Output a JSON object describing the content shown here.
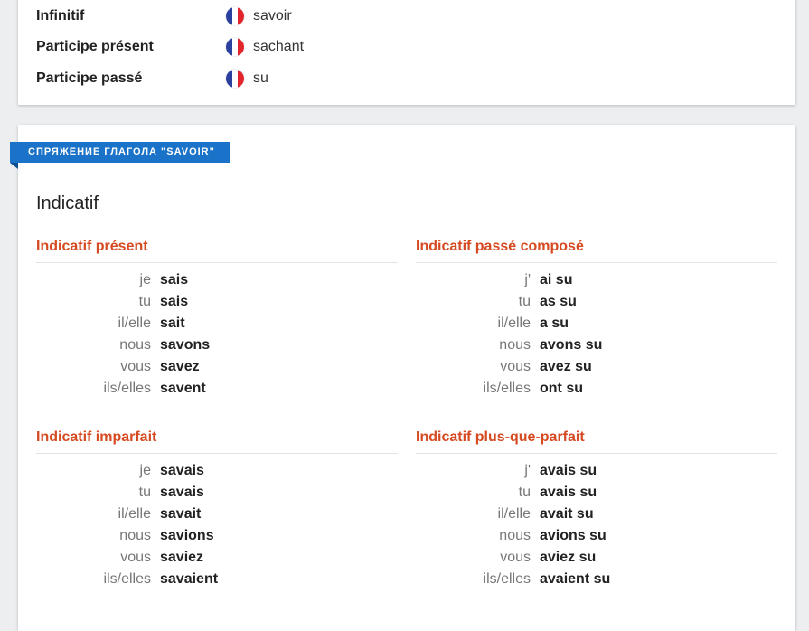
{
  "forms": [
    {
      "label": "Infinitif",
      "value": "savoir"
    },
    {
      "label": "Participe présent",
      "value": "sachant"
    },
    {
      "label": "Participe passé",
      "value": "su"
    }
  ],
  "section": {
    "ribbon": "СПРЯЖЕНИЕ ГЛАГОЛА \"SAVOIR\"",
    "mood": "Indicatif"
  },
  "tenses": [
    {
      "title": "Indicatif présent",
      "rows": [
        {
          "pronoun": "je",
          "verb": "sais"
        },
        {
          "pronoun": "tu",
          "verb": "sais"
        },
        {
          "pronoun": "il/elle",
          "verb": "sait"
        },
        {
          "pronoun": "nous",
          "verb": "savons"
        },
        {
          "pronoun": "vous",
          "verb": "savez"
        },
        {
          "pronoun": "ils/elles",
          "verb": "savent"
        }
      ]
    },
    {
      "title": "Indicatif passé composé",
      "rows": [
        {
          "pronoun": "j'",
          "verb": "ai su"
        },
        {
          "pronoun": "tu",
          "verb": "as su"
        },
        {
          "pronoun": "il/elle",
          "verb": "a su"
        },
        {
          "pronoun": "nous",
          "verb": "avons su"
        },
        {
          "pronoun": "vous",
          "verb": "avez su"
        },
        {
          "pronoun": "ils/elles",
          "verb": "ont su"
        }
      ]
    },
    {
      "title": "Indicatif imparfait",
      "rows": [
        {
          "pronoun": "je",
          "verb": "savais"
        },
        {
          "pronoun": "tu",
          "verb": "savais"
        },
        {
          "pronoun": "il/elle",
          "verb": "savait"
        },
        {
          "pronoun": "nous",
          "verb": "savions"
        },
        {
          "pronoun": "vous",
          "verb": "saviez"
        },
        {
          "pronoun": "ils/elles",
          "verb": "savaient"
        }
      ]
    },
    {
      "title": "Indicatif plus-que-parfait",
      "rows": [
        {
          "pronoun": "j'",
          "verb": "avais su"
        },
        {
          "pronoun": "tu",
          "verb": "avais su"
        },
        {
          "pronoun": "il/elle",
          "verb": "avait su"
        },
        {
          "pronoun": "nous",
          "verb": "avions su"
        },
        {
          "pronoun": "vous",
          "verb": "aviez su"
        },
        {
          "pronoun": "ils/elles",
          "verb": "avaient su"
        }
      ]
    }
  ],
  "icons": {
    "flag": "france-flag-icon"
  },
  "colors": {
    "accent_blue": "#1a73c8",
    "tense_title": "#d54a21",
    "flag_blue": "#2b3f9e",
    "flag_red": "#e2252b"
  }
}
